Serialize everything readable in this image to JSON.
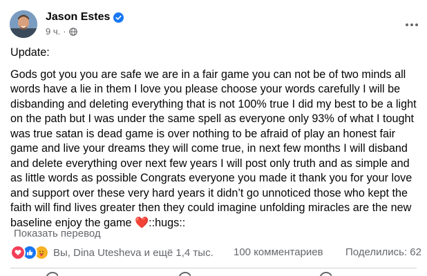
{
  "post": {
    "author": "Jason Estes",
    "timestamp": "9 ч.",
    "separator": "·",
    "update_label": "Update:",
    "body_text": "Gods got you you are safe we are in a fair game you can not be of two minds all words have a lie in them I love you please choose your words carefully I will be disbanding and deleting everything that is not 100% true I did my best to be a light on the path but I was under the same spell as everyone only 93% of what I tought was true satan is dead game is over nothing to be afraid of play an honest fair game and live your dreams they will come true, in next few months I will disband and delete everything over next few years I will post only truth and as simple and as little words as possible Congrats everyone you made it thank you for your love and support over these very hard years it didn’t go unnoticed those who kept the faith will find lives greater then they could imagine unfolding miracles are the new baseline enjoy the game ",
    "heart_emoji": "❤️",
    "hugs_text": "::hugs::",
    "translate_link": "Показать перевод"
  },
  "stats": {
    "reaction_names": "Вы, Dina Utesheva и ещё 1,4 тыс.",
    "comments": "100 комментариев",
    "shares": "Поделились: 62"
  },
  "icons": {
    "verified": "verified-badge-icon",
    "privacy": "globe-icon",
    "more": "more-options-icon",
    "reactions": [
      "love-reaction-icon",
      "like-reaction-icon",
      "care-reaction-icon"
    ]
  },
  "colors": {
    "accent": "#1877f2",
    "love": "#f33e58",
    "care": "#f7b125",
    "secondary_text": "#65676b"
  }
}
